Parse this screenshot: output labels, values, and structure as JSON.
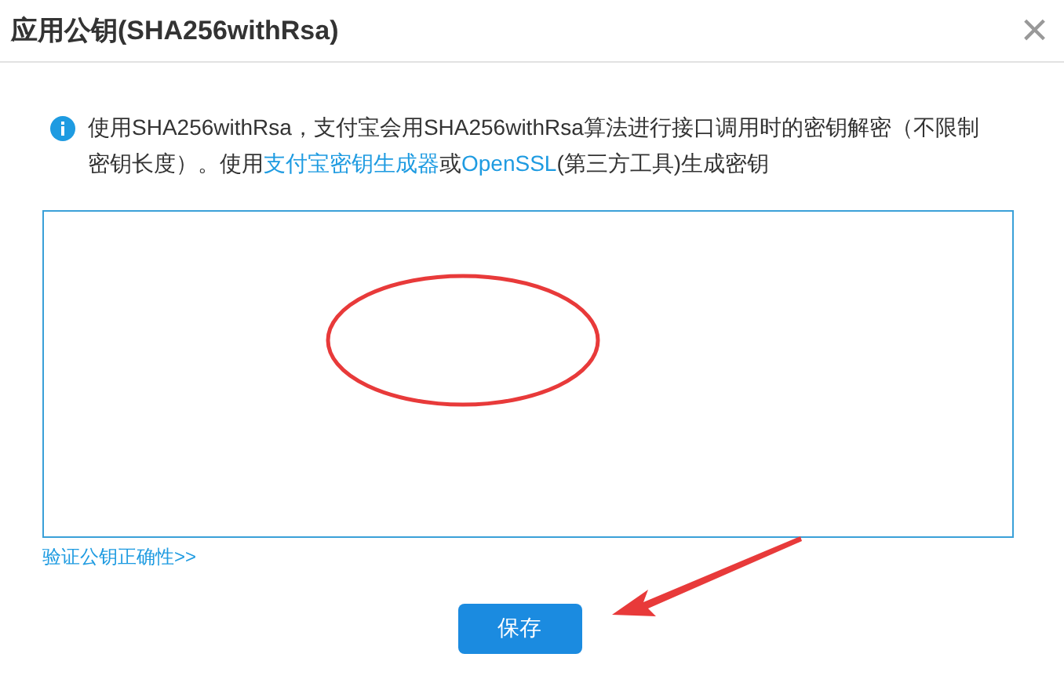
{
  "dialog": {
    "title": "应用公钥(SHA256withRsa)",
    "close": "×"
  },
  "notice": {
    "segments": [
      {
        "kind": "text",
        "text": "使用SHA256withRsa，支付宝会用SHA256withRsa算法进行接口调用时的密钥解密（不限制密钥长度）。使用"
      },
      {
        "kind": "link",
        "text": "支付宝密钥生成器"
      },
      {
        "kind": "text",
        "text": "或"
      },
      {
        "kind": "link",
        "text": "OpenSSL"
      },
      {
        "kind": "text",
        "text": "(第三方工具)生成密钥"
      }
    ]
  },
  "verify_link": "验证公钥正确性>>",
  "save_button": "保存"
}
